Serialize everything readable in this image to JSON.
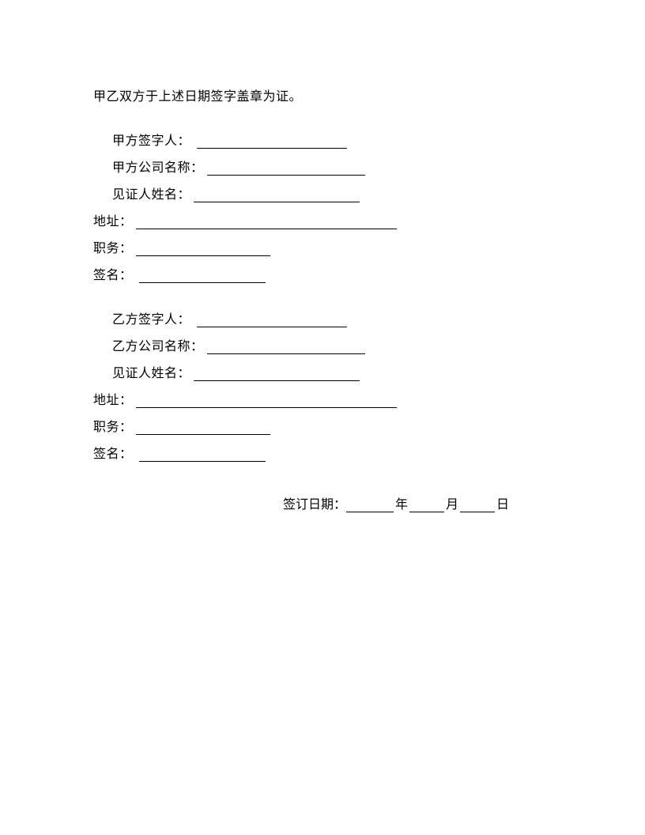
{
  "intro": "甲乙双方于上述日期签字盖章为证。",
  "partyA": {
    "signer_label": "甲方签字人：",
    "company_label": "甲方公司名称：",
    "witness_label": "见证人姓名：",
    "address_label": "地址：",
    "position_label": "职务：",
    "signature_label": "签名："
  },
  "partyB": {
    "signer_label": "乙方签字人：",
    "company_label": "乙方公司名称：",
    "witness_label": "见证人姓名：",
    "address_label": "地址：",
    "position_label": "职务：",
    "signature_label": "签名："
  },
  "date": {
    "label": "签订日期：",
    "year_unit": "年",
    "month_unit": "月",
    "day_unit": "日"
  }
}
